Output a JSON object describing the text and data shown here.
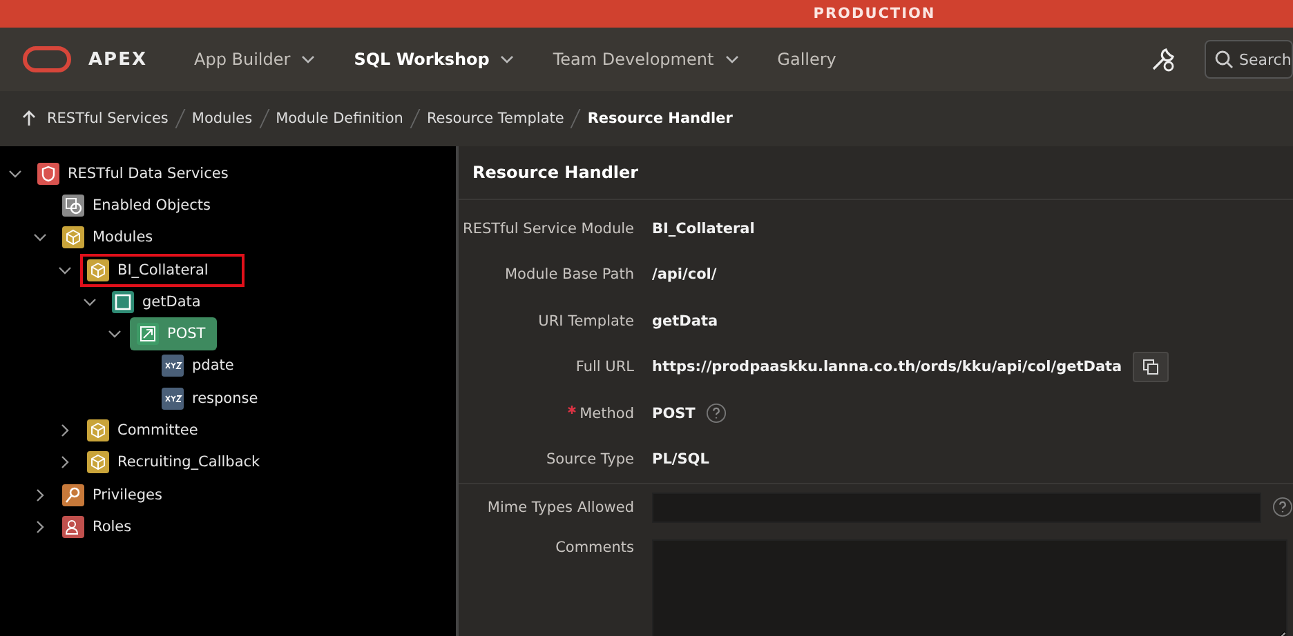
{
  "environment_banner": "PRODUCTION",
  "header": {
    "logo_text": "APEX",
    "nav": [
      {
        "label": "App Builder",
        "selected": false,
        "dropdown": true
      },
      {
        "label": "SQL Workshop",
        "selected": true,
        "dropdown": true
      },
      {
        "label": "Team Development",
        "selected": false,
        "dropdown": true
      },
      {
        "label": "Gallery",
        "selected": false,
        "dropdown": false
      }
    ],
    "search": {
      "placeholder": "Search"
    }
  },
  "breadcrumb": [
    {
      "label": "RESTful Services",
      "selected": false
    },
    {
      "label": "Modules",
      "selected": false
    },
    {
      "label": "Module Definition",
      "selected": false
    },
    {
      "label": "Resource Template",
      "selected": false
    },
    {
      "label": "Resource Handler",
      "selected": true
    }
  ],
  "tree": [
    {
      "label": "RESTful Data Services",
      "kind": "service",
      "expanded": true,
      "selected": false,
      "highlighted": false,
      "children": [
        {
          "label": "Enabled Objects",
          "kind": "objects",
          "selected": false,
          "highlighted": false
        },
        {
          "label": "Modules",
          "kind": "modules",
          "expanded": true,
          "selected": false,
          "highlighted": false,
          "children": [
            {
              "label": "BI_Collateral",
              "kind": "module",
              "expanded": true,
              "selected": false,
              "highlighted": true,
              "children": [
                {
                  "label": "getData",
                  "kind": "template",
                  "expanded": true,
                  "selected": false,
                  "highlighted": false,
                  "children": [
                    {
                      "label": "POST",
                      "kind": "handler",
                      "expanded": true,
                      "selected": true,
                      "highlighted": false,
                      "children": [
                        {
                          "label": "pdate",
                          "kind": "parameter",
                          "selected": false,
                          "highlighted": false
                        },
                        {
                          "label": "response",
                          "kind": "parameter",
                          "selected": false,
                          "highlighted": false
                        }
                      ]
                    }
                  ]
                }
              ]
            },
            {
              "label": "Committee",
              "kind": "module",
              "expanded": false,
              "selected": false,
              "highlighted": false
            },
            {
              "label": "Recruiting_Callback",
              "kind": "module",
              "expanded": false,
              "selected": false,
              "highlighted": false
            }
          ]
        },
        {
          "label": "Privileges",
          "kind": "privileges",
          "expanded": false,
          "selected": false,
          "highlighted": false
        },
        {
          "label": "Roles",
          "kind": "roles",
          "expanded": false,
          "selected": false,
          "highlighted": false
        }
      ]
    }
  ],
  "panel": {
    "title": "Resource Handler",
    "fields": [
      {
        "label": "RESTful Service Module",
        "kind": "display",
        "value": "BI_Collateral"
      },
      {
        "label": "Module Base Path",
        "kind": "display",
        "value": "/api/col/"
      },
      {
        "label": "URI Template",
        "kind": "display",
        "value": "getData"
      },
      {
        "label": "Full URL",
        "kind": "display",
        "value": "https://prodpaaskku.lanna.co.th/ords/kku/api/col/getData",
        "copy": true
      },
      {
        "label": "Method",
        "kind": "display",
        "value": "POST",
        "required": true,
        "help": true
      },
      {
        "label": "Source Type",
        "kind": "display",
        "value": "PL/SQL"
      },
      {
        "label": "Mime Types Allowed",
        "kind": "input",
        "help": true
      },
      {
        "label": "Comments",
        "kind": "textarea"
      }
    ]
  }
}
